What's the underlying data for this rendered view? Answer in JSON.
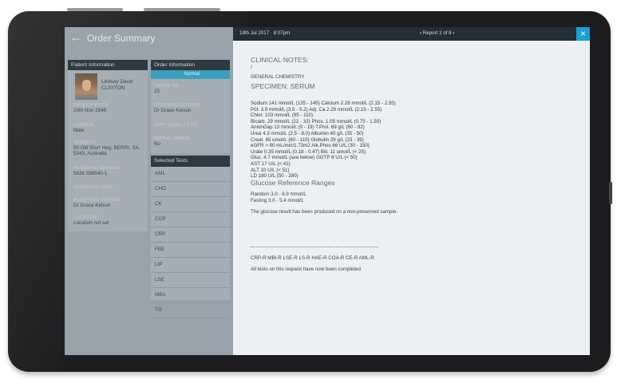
{
  "order_summary": {
    "title": "Order Summary",
    "patient_info": {
      "header": "Patient Information",
      "name_line1": "Lindsay David",
      "name_line2": "CLAYTON",
      "dob_label": "DATE OF BIRTH",
      "dob_value": "10th Nov 1946",
      "gender_label": "GENDER",
      "gender_value": "Male",
      "address_label": "ADDRESS",
      "address_line1": "50 Old Sturt Hwy, BERRI, SA,",
      "address_line2": "5343, Australia",
      "medicare_label": "MEDICARE NUMBER",
      "medicare_value": "5636 598540-1",
      "admission_label": "ADMISSION DATE",
      "admitting_label": "ADMITTING DOCTOR",
      "admitting_value": "Dr Grace Kelson",
      "location_label": "LOCATION",
      "location_value": "Location not set"
    },
    "order_info": {
      "header": "Order Information",
      "status": "Normal",
      "order_no_label": "ORDER NO",
      "order_no_value": "25",
      "ordering_label": "ORDERING DOCTOR",
      "ordering_value": "Dr Grace Kelson",
      "copy_label": "COPY RESULTS TO",
      "repeat_label": "REPEAT ORDER",
      "repeat_value": "No"
    },
    "selected_tests": {
      "header": "Selected Tests",
      "items": [
        "AML",
        "CHO",
        "CK",
        "COP",
        "CRP",
        "FBE",
        "LIP",
        "LSE",
        "MBA",
        "TG"
      ]
    }
  },
  "report": {
    "date": "18th Jul 2017 · 8:07pm",
    "nav_prev": "‹",
    "nav_label": "Report 2 of 8",
    "nav_next": "›",
    "close_icon": "×",
    "clinical_notes": "CLINICAL NOTES:",
    "clinical_notes_value": "/",
    "section": "GENERAL CHEMISTRY",
    "specimen": "SPECIMEN: SERUM",
    "results": [
      "Sodium 141 mmol/L (135 - 145) Calcium 2.29 mmol/L (2.15 - 2.55)",
      "Pot. 3.9 mmol/L (3.5 - 5.2) Adj. Ca 2.29 mmol/L (2.15 - 2.55)",
      "Chlor. 103 mmol/L (95 - 110)",
      "Bicarb. 29 mmol/L (22 - 32) Phos. 1.05 mmol/L (0.75 - 1.50)",
      "AnionGap 13 mmol/L (9 - 19) T.Prot. 69 g/L (60 - 82)",
      "Urea 4.3 mmol/L (2.5 - 8.0) Albumin 40 g/L (35 - 50)",
      "Creat. 65 umol/L (60 - 110) Globulin 29 g/L (23 - 39)",
      "eGFR > 90 mL/min/1.73m2 Alk.Phos 66 U/L (30 - 150)",
      "Urate 0.35 mmol/L (0.18 - 0.47) Bili. 11 umol/L (< 25)",
      "Gluc. 4.7 mmol/L (see below) GGTP 8 U/L (< 50)",
      "AST 17 U/L (< 41)",
      "ALT 10 U/L (< 51)",
      "LD 180 U/L (50 - 280)"
    ],
    "glucose_heading": "Glucose Reference Ranges",
    "glucose_random": "Random 3.0 - 6.9 mmol/L",
    "glucose_fasting": "Fasting 3.0 - 5.4 mmol/L",
    "glucose_note": "The glucose result has been produced on a non-preserved sample.",
    "codes": "CRP-R MBI-R LSE-R LS-R HAE-R COA-R CE-R AML-R",
    "complete_note": "All tests on this request have now been completed"
  }
}
